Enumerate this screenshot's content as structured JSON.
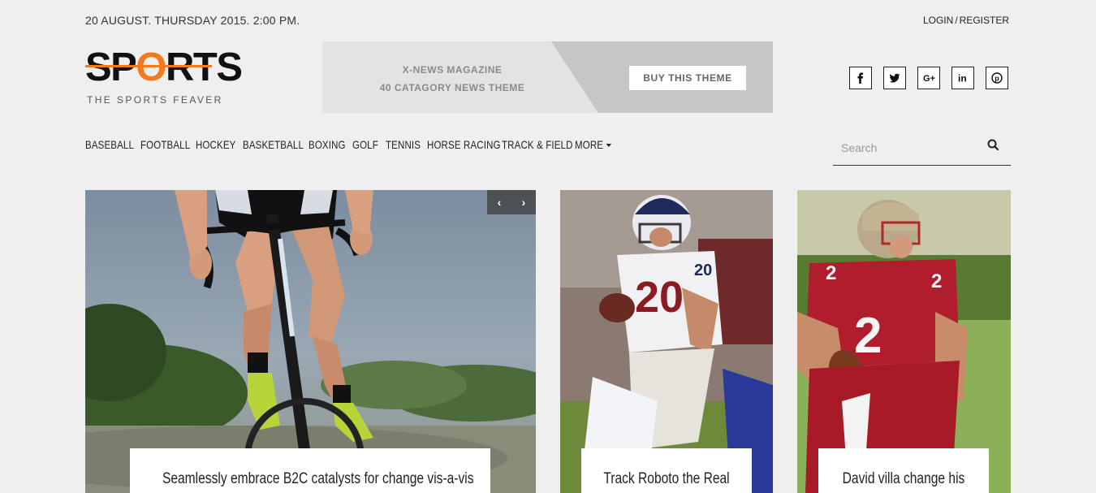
{
  "topbar": {
    "date": "20 AUGUST. THURSDAY 2015. 2:00 PM.",
    "login": "LOGIN",
    "separator": "/",
    "register": "REGISTER"
  },
  "logo": {
    "word_start": "SP",
    "word_o": "O",
    "word_end": "RTS",
    "tagline": "THE SPORTS FEAVER",
    "accent_color": "#f47a20"
  },
  "banner": {
    "title": "X-NEWS MAGAZINE",
    "subtitle": "40 CATAGORY NEWS THEME",
    "button": "BUY THIS THEME"
  },
  "social": [
    "facebook-icon",
    "twitter-icon",
    "google-plus-icon",
    "linkedin-icon",
    "pinterest-icon"
  ],
  "nav": {
    "items": [
      "BASEBALL",
      "FOOTBALL",
      "HOCKEY",
      "BASKETBALL",
      "BOXING",
      "GOLF",
      "TENNIS",
      "HORSE RACING",
      "TRACK & FIELD"
    ],
    "more": "MORE"
  },
  "search": {
    "placeholder": "Search"
  },
  "slider": {
    "prev": "‹",
    "next": "›"
  },
  "cards": [
    {
      "caption": "Seamlessly embrace B2C catalysts for change vis-a-vis"
    },
    {
      "caption": "Track Roboto the Real"
    },
    {
      "caption": "David villa change his"
    }
  ]
}
